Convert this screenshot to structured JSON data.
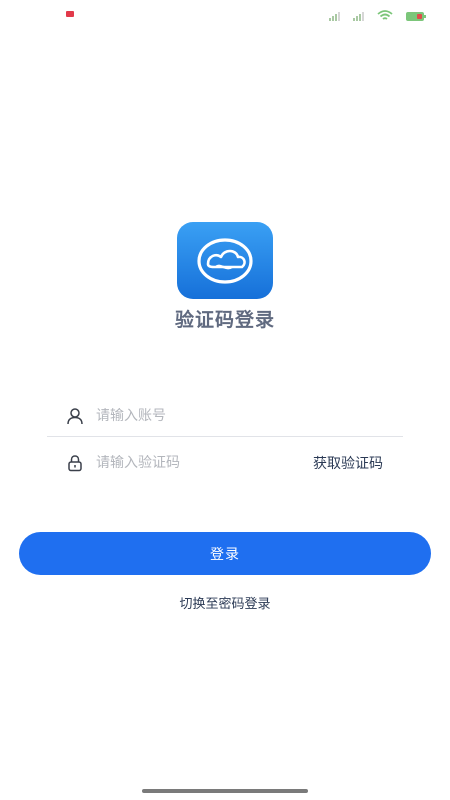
{
  "status_bar": {
    "icons": [
      "notification-badge-icon",
      "signal-icon",
      "signal-icon",
      "wifi-icon",
      "battery-icon"
    ]
  },
  "header": {
    "logo_icon": "cloud-logo-icon",
    "title": "验证码登录"
  },
  "form": {
    "account": {
      "icon": "user-icon",
      "placeholder": "请输入账号",
      "value": ""
    },
    "code": {
      "icon": "lock-icon",
      "placeholder": "请输入验证码",
      "value": "",
      "get_code_label": "获取验证码"
    },
    "submit_label": "登录",
    "switch_label": "切换至密码登录"
  },
  "colors": {
    "primary": "#1f6ff0",
    "title": "#606a80",
    "link": "#2b3a55",
    "placeholder": "#b3b6bc"
  }
}
